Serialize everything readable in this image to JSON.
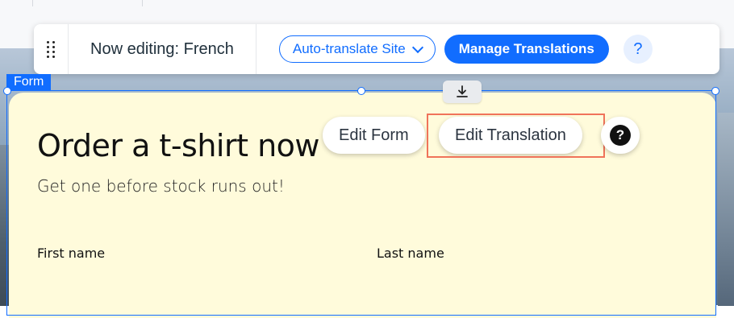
{
  "toolbar": {
    "editing_label": "Now editing: French",
    "auto_translate_label": "Auto-translate Site",
    "manage_translations_label": "Manage Translations",
    "help_label": "?"
  },
  "form_tag": "Form",
  "form": {
    "title": "Order a t-shirt now",
    "subtitle": "Get one before stock runs out!",
    "fields": [
      {
        "label": "First name"
      },
      {
        "label": "Last name"
      }
    ]
  },
  "actions": {
    "edit_form_label": "Edit Form",
    "edit_translation_label": "Edit Translation",
    "help_label": "?"
  },
  "colors": {
    "accent": "#116dff",
    "form_background": "#fffbdb",
    "highlight": "#f0735a"
  },
  "icons": {
    "drag": "drag-handle-icon",
    "chevron": "chevron-down-icon",
    "help": "question-mark-icon",
    "anchor": "download-arrow-icon"
  }
}
